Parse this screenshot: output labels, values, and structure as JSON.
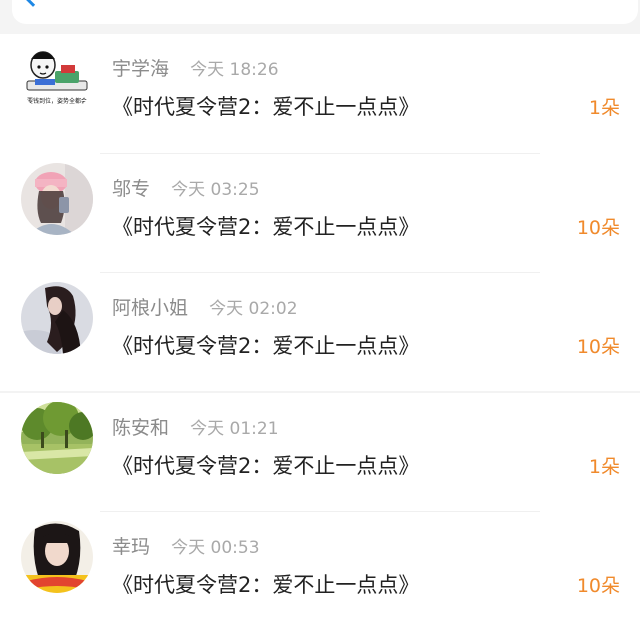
{
  "colors": {
    "accent_back": "#1e88e5",
    "name": "#8b8b8b",
    "time": "#a9a9a9",
    "title": "#222222",
    "count": "#f08a2c"
  },
  "topbar": {
    "back_icon": "chevron-left-icon"
  },
  "entries": [
    {
      "name": "宇学海",
      "time": "今天 18:26",
      "title": "《时代夏令营2：爱不止一点点》",
      "count": "1朵",
      "avatar_text": "要钱到位，姿势全都会"
    },
    {
      "name": "邬专",
      "time": "今天 03:25",
      "title": "《时代夏令营2：爱不止一点点》",
      "count": "10朵"
    },
    {
      "name": "阿桹小姐",
      "time": "今天 02:02",
      "title": "《时代夏令营2：爱不止一点点》",
      "count": "10朵"
    },
    {
      "name": "陈安和",
      "time": "今天 01:21",
      "title": "《时代夏令营2：爱不止一点点》",
      "count": "1朵"
    },
    {
      "name": "幸玛",
      "time": "今天 00:53",
      "title": "《时代夏令营2：爱不止一点点》",
      "count": "10朵"
    }
  ]
}
